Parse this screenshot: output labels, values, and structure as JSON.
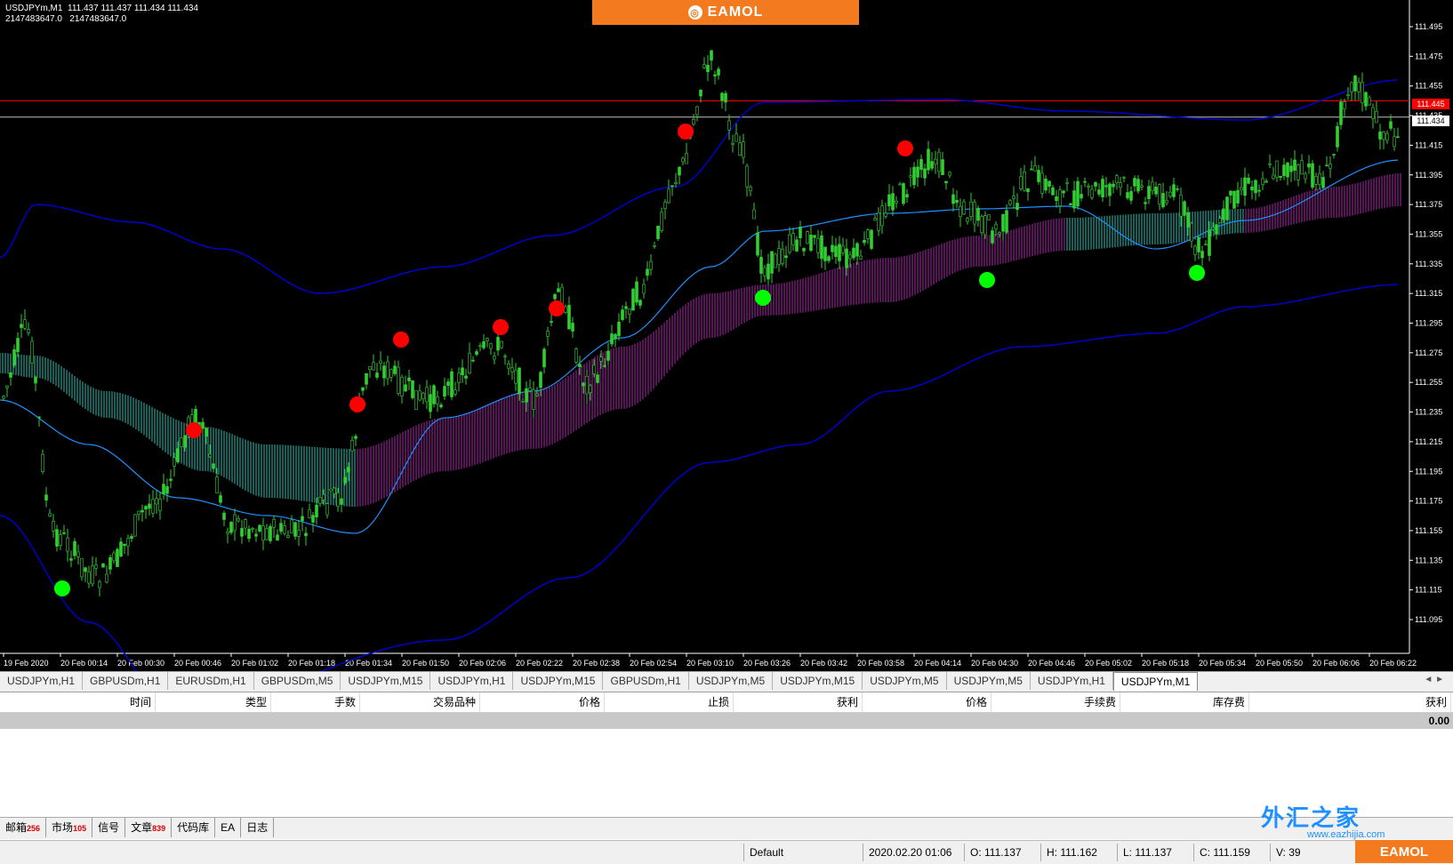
{
  "chart": {
    "header_line1": "USDJPYm,M1  111.437 111.437 111.434 111.434",
    "header_line2": "2147483647.0   2147483647.0",
    "brand": "EAMOL",
    "price_line_red": "111.445",
    "price_line_current": "111.434",
    "price_axis": [
      "111.495",
      "111.475",
      "111.455",
      "111.435",
      "111.415",
      "111.395",
      "111.375",
      "111.355",
      "111.335",
      "111.315",
      "111.295",
      "111.275",
      "111.255",
      "111.235",
      "111.215",
      "111.195",
      "111.175",
      "111.155",
      "111.135",
      "111.115",
      "111.095"
    ],
    "time_axis": [
      "19 Feb 2020",
      "20 Feb 00:14",
      "20 Feb 00:30",
      "20 Feb 00:46",
      "20 Feb 01:02",
      "20 Feb 01:18",
      "20 Feb 01:34",
      "20 Feb 01:50",
      "20 Feb 02:06",
      "20 Feb 02:22",
      "20 Feb 02:38",
      "20 Feb 02:54",
      "20 Feb 03:10",
      "20 Feb 03:26",
      "20 Feb 03:42",
      "20 Feb 03:58",
      "20 Feb 04:14",
      "20 Feb 04:30",
      "20 Feb 04:46",
      "20 Feb 05:02",
      "20 Feb 05:18",
      "20 Feb 05:34",
      "20 Feb 05:50",
      "20 Feb 06:06",
      "20 Feb 06:22"
    ],
    "colors": {
      "bull": "#32cd32",
      "signal_sell": "#ff0000",
      "signal_buy": "#00ff00",
      "band": "#0000cd",
      "ma": "#1e90ff",
      "cloud_up": "#40e0d0",
      "cloud_down": "#cc33cc",
      "level_red": "#ff0000"
    }
  },
  "tabs": [
    "USDJPYm,H1",
    "GBPUSDm,H1",
    "EURUSDm,H1",
    "GBPUSDm,M5",
    "USDJPYm,M15",
    "USDJPYm,H1",
    "USDJPYm,M15",
    "GBPUSDm,H1",
    "USDJPYm,M5",
    "USDJPYm,M15",
    "USDJPYm,M5",
    "USDJPYm,M5",
    "USDJPYm,H1",
    "USDJPYm,M1"
  ],
  "grid": {
    "columns": [
      "时间",
      "类型",
      "手数",
      "交易品种",
      "价格",
      "止损",
      "获利",
      "价格",
      "手续费",
      "库存费",
      "获利"
    ],
    "total": "0.00"
  },
  "bottom_tabs": [
    {
      "label": "邮箱",
      "badge": "256"
    },
    {
      "label": "市场",
      "badge": "105"
    },
    {
      "label": "信号",
      "badge": ""
    },
    {
      "label": "文章",
      "badge": "839"
    },
    {
      "label": "代码库",
      "badge": ""
    },
    {
      "label": "EA",
      "badge": ""
    },
    {
      "label": "日志",
      "badge": ""
    }
  ],
  "status": {
    "profile": "Default",
    "datetime": "2020.02.20 01:06",
    "open": "O: 111.137",
    "high": "H: 111.162",
    "low": "L: 111.137",
    "close": "C: 111.159",
    "volume": "V: 39"
  },
  "watermark": {
    "text": "外汇之家",
    "url": "www.eazhijia.com"
  }
}
